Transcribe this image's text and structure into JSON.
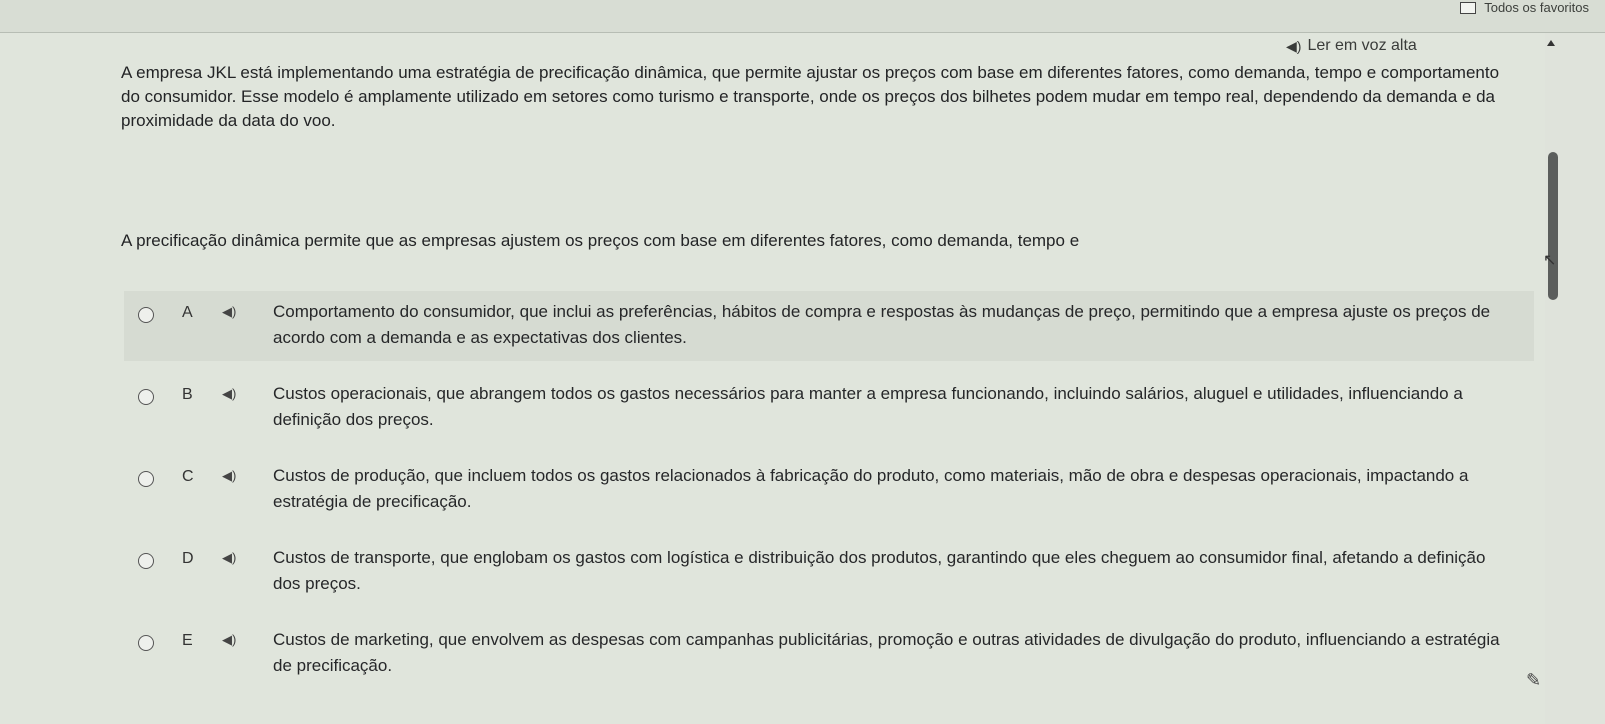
{
  "browser": {
    "favorites_label": "Todos os favoritos"
  },
  "toolbar": {
    "read_aloud_label": "Ler em voz alta",
    "speaker_icon": "speaker-icon"
  },
  "passage": "A empresa JKL está implementando uma estratégia de precificação dinâmica, que permite ajustar os preços com base em diferentes fatores, como demanda, tempo e comportamento do consumidor. Esse modelo é amplamente utilizado em setores como turismo e transporte, onde os preços dos bilhetes podem mudar em tempo real, dependendo da demanda e da proximidade da data do voo.",
  "prompt": "A precificação dinâmica permite que as empresas ajustem os preços com base em diferentes fatores, como demanda, tempo e",
  "options": [
    {
      "letter": "A",
      "text": "Comportamento do consumidor, que inclui as preferências, hábitos de compra e respostas às mudanças de preço, permitindo que a empresa ajuste os preços de acordo com a demanda e as expectativas dos clientes."
    },
    {
      "letter": "B",
      "text": "Custos operacionais, que abrangem todos os gastos necessários para manter a empresa funcionando, incluindo salários, aluguel e utilidades, influenciando a definição dos preços."
    },
    {
      "letter": "C",
      "text": "Custos de produção, que incluem todos os gastos relacionados à fabricação do produto, como materiais, mão de obra e despesas operacionais, impactando a estratégia de precificação."
    },
    {
      "letter": "D",
      "text": "Custos de transporte, que englobam os gastos com logística e distribuição dos produtos, garantindo que eles cheguem ao consumidor final, afetando a definição dos preços."
    },
    {
      "letter": "E",
      "text": "Custos de marketing, que envolvem as despesas com campanhas publicitárias, promoção e outras atividades de divulgação do produto, influenciando a estratégia de precificação."
    }
  ]
}
